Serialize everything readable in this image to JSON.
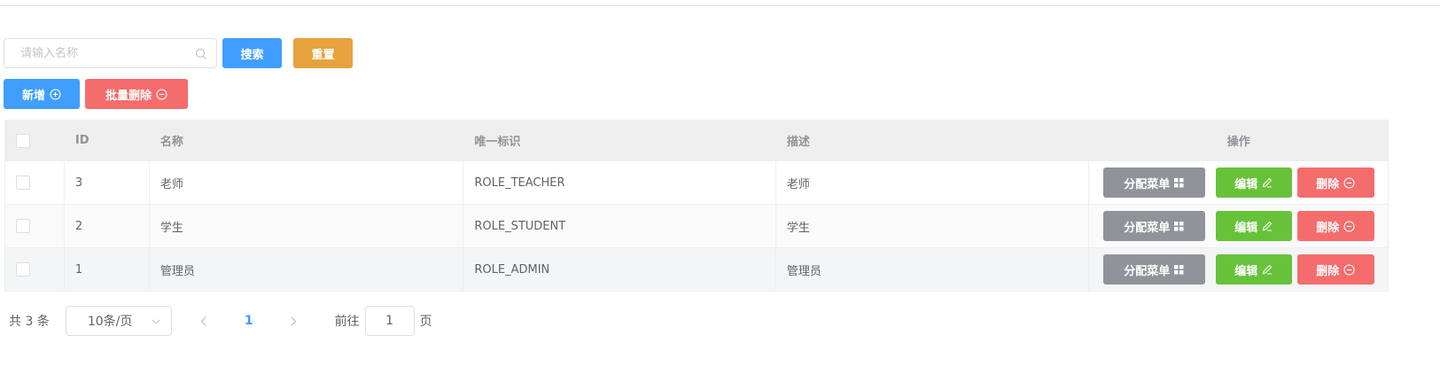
{
  "search": {
    "placeholder": "请输入名称",
    "value": "",
    "search_label": "搜索",
    "reset_label": "重置"
  },
  "actions": {
    "add_label": "新增",
    "batch_delete_label": "批量删除"
  },
  "table": {
    "headers": {
      "id": "ID",
      "name": "名称",
      "key": "唯一标识",
      "desc": "描述",
      "ops": "操作"
    },
    "rows": [
      {
        "id": "3",
        "name": "老师",
        "key": "ROLE_TEACHER",
        "desc": "老师"
      },
      {
        "id": "2",
        "name": "学生",
        "key": "ROLE_STUDENT",
        "desc": "学生"
      },
      {
        "id": "1",
        "name": "管理员",
        "key": "ROLE_ADMIN",
        "desc": "管理员"
      }
    ],
    "row_buttons": {
      "assign_label": "分配菜单",
      "edit_label": "编辑",
      "delete_label": "删除"
    }
  },
  "pagination": {
    "total_text": "共 3 条",
    "page_size": "10条/页",
    "current_page": "1",
    "goto_prefix": "前往",
    "goto_value": "1",
    "goto_suffix": "页"
  },
  "colors": {
    "primary": "#409eff",
    "warning": "#e6a23c",
    "danger": "#f56c6c",
    "success": "#67c23a",
    "info": "#909399"
  },
  "icons": [
    "search-icon",
    "plus-circle-icon",
    "minus-circle-icon",
    "grid-icon",
    "pencil-icon",
    "chevron-down-icon",
    "chevron-left-icon",
    "chevron-right-icon"
  ]
}
